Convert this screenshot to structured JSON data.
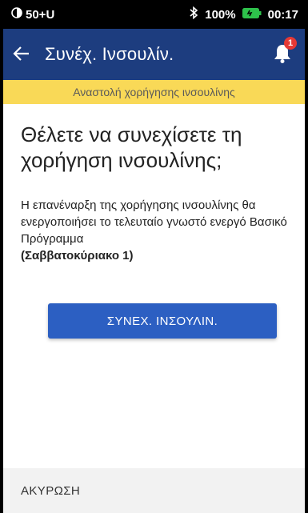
{
  "status_bar": {
    "left_text": "50+U",
    "bluetooth_icon": "bluetooth-icon",
    "battery_percent": "100%",
    "battery_level": 1.0,
    "time": "00:17"
  },
  "app_bar": {
    "title": "Συνέχ. Ινσουλίν.",
    "notification_count": "1"
  },
  "banner": {
    "text": "Αναστολή χορήγησης ινσουλίνης"
  },
  "main": {
    "heading": "Θέλετε να συνεχίσετε τη χορήγηση ινσουλίνης;",
    "body": "Η επανέναρξη της χορήγησης ινσουλίνης θα ενεργοποιήσει το τελευταίο γνωστό ενεργό Βασικό Πρόγραμμα",
    "program_name": "(Σαββατοκύριακο 1)",
    "resume_button": "ΣΥΝΕΧ. ΙΝΣΟΥΛΙΝ."
  },
  "footer": {
    "cancel_label": "ΑΚΥΡΩΣΗ"
  },
  "colors": {
    "app_bar": "#1d3d7f",
    "banner": "#f9d957",
    "button": "#2c5fc2",
    "badge": "#e53935"
  }
}
